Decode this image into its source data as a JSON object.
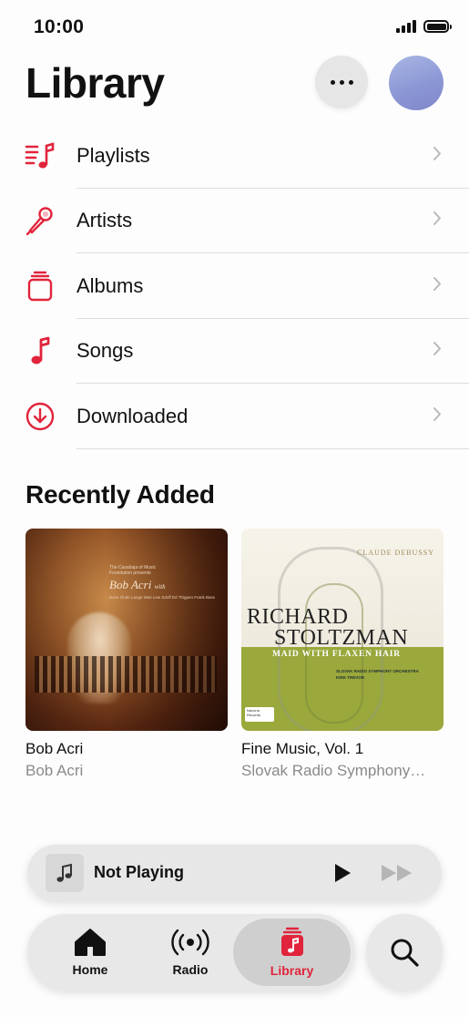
{
  "status_bar": {
    "time": "10:00"
  },
  "header": {
    "title": "Library"
  },
  "library_items": [
    {
      "label": "Playlists",
      "icon": "playlist-icon"
    },
    {
      "label": "Artists",
      "icon": "microphone-icon"
    },
    {
      "label": "Albums",
      "icon": "album-stack-icon"
    },
    {
      "label": "Songs",
      "icon": "music-note-icon"
    },
    {
      "label": "Downloaded",
      "icon": "download-circle-icon"
    }
  ],
  "recently_added": {
    "title": "Recently Added",
    "albums": [
      {
        "title": "Bob Acri",
        "artist": "Bob Acri",
        "art_text": {
          "presenter": "The Casabaja of Music Foundation presents",
          "name": "Bob Acri",
          "with": "with",
          "credits": "Dave Onde Lange Was Lew Sdoff Ed Thigpen Frank Bass"
        }
      },
      {
        "title": "Fine Music, Vol. 1",
        "artist": "Slovak Radio Symphony…",
        "art_text": {
          "composer": "CLAUDE DEBUSSY",
          "name_line1": "RICHARD",
          "name_line2": "STOLTZMAN",
          "piece": "MAID WITH FLAXEN HAIR",
          "orchestra": "SLOVAK RADIO SYMPHONY ORCHESTRA",
          "conductor": "KIRK TREVOR",
          "record_label": "Navona Records"
        }
      }
    ]
  },
  "mini_player": {
    "title": "Not Playing"
  },
  "tab_bar": {
    "tabs": [
      {
        "label": "Home",
        "icon": "home-icon"
      },
      {
        "label": "Radio",
        "icon": "radio-waves-icon"
      },
      {
        "label": "Library",
        "icon": "library-icon",
        "active": true
      }
    ],
    "search_icon": "search-icon"
  },
  "colors": {
    "accent": "#e1243b",
    "secondary_text": "#8a8a8a",
    "separator": "#dcdcdc"
  }
}
